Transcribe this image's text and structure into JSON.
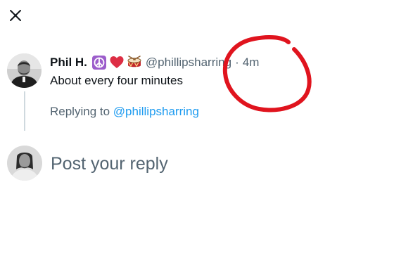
{
  "tweet": {
    "author_name": "Phil H.",
    "handle": "@phillipsharring",
    "separator": "·",
    "timestamp": "4m",
    "text": "About every four minutes",
    "badges": [
      "peace-symbol-icon",
      "red-heart-icon",
      "drum-icon"
    ]
  },
  "reply_context": {
    "prefix": "Replying to",
    "mention": "@phillipsharring"
  },
  "composer": {
    "placeholder": "Post your reply"
  },
  "annotation": {
    "color": "#e0141e",
    "shape": "hand-drawn circle around timestamp"
  },
  "colors": {
    "text_primary": "#0f1419",
    "text_secondary": "#536471",
    "link": "#1d9bf0",
    "thread_line": "#cfd9de"
  }
}
